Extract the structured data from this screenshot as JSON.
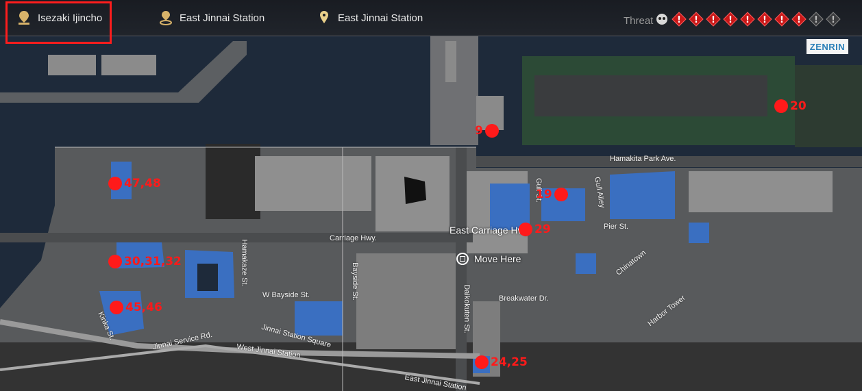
{
  "header": {
    "locations": [
      {
        "label": "Isezaki Ijincho",
        "icon": "district-pin-icon"
      },
      {
        "label": "East Jinnai Station",
        "icon": "station-pin-icon"
      },
      {
        "label": "East Jinnai Station",
        "icon": "location-pin-icon"
      }
    ],
    "threat_label": "Threat",
    "threat_level": 8,
    "threat_max": 10
  },
  "map": {
    "badge": "ZENRIN",
    "streets": [
      "Hamakita Park Ave.",
      "Gull St.",
      "Gull Alley",
      "Pier St.",
      "Chinatown",
      "Carriage Hwy.",
      "Bayside St.",
      "Hamakaze St.",
      "W Bayside St.",
      "Daikokuten St.",
      "Breakwater Dr.",
      "Harbor Tower",
      "Kinka St.",
      "Jinnai Station Square",
      "Jinnai Service Rd.",
      "West Jinnai Station",
      "East Jinnai Station"
    ],
    "current_label": "East Carriage Hwy",
    "move_action": "Move Here"
  },
  "markers": [
    "20",
    "9",
    "47,48",
    "19",
    "29",
    "30,31,32",
    "45,46",
    "24,25"
  ],
  "colors": {
    "marker": "#ff1a1a",
    "highlight": "#ff1d1d",
    "building_blue": "#3a6fc1",
    "water": "#1e2a3a",
    "land": "#585a5c",
    "park": "#2c4a36"
  }
}
